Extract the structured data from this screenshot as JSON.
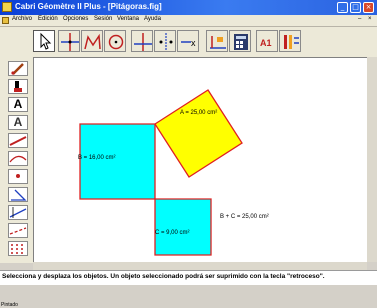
{
  "window": {
    "title": "Cabri Géomètre II Plus - [Pitágoras.fig]",
    "min_glyph": "_",
    "max_glyph": "□",
    "close_glyph": "×"
  },
  "menu": {
    "items": [
      "Archivo",
      "Edición",
      "Opciones",
      "Sesión",
      "Ventana",
      "Ayuda"
    ],
    "doc_min": "–",
    "doc_close": "×"
  },
  "toolbar": {
    "buttons": [
      "pointer-tool",
      "point-on-lines-tool",
      "triangle-tool",
      "circle-tool",
      "perpendicular-tool",
      "symmetry-tool",
      "vector-tool",
      "measure-tool",
      "calculator-tool",
      "text-tool",
      "display-tool"
    ],
    "text_tool_label": "A1"
  },
  "lefttools": {
    "text_glyph": "A",
    "label_glyph": "A"
  },
  "canvas": {
    "squares": [
      {
        "name": "A",
        "label": "A = 25,00 cm²",
        "fill": "#ffff00"
      },
      {
        "name": "B",
        "label": "B = 16,00 cm²",
        "fill": "#00ffff"
      },
      {
        "name": "C",
        "label": "C = 9,00 cm²",
        "fill": "#00ffff"
      }
    ],
    "sum_label": "B + C = 25,00 cm²",
    "edge_color": "#e02020"
  },
  "status": {
    "message": "Selecciona y desplaza los objetos. Un objeto seleccionado podrá ser suprimido con la tecla \"retroceso\".",
    "taskbar_label": "Pintado"
  }
}
